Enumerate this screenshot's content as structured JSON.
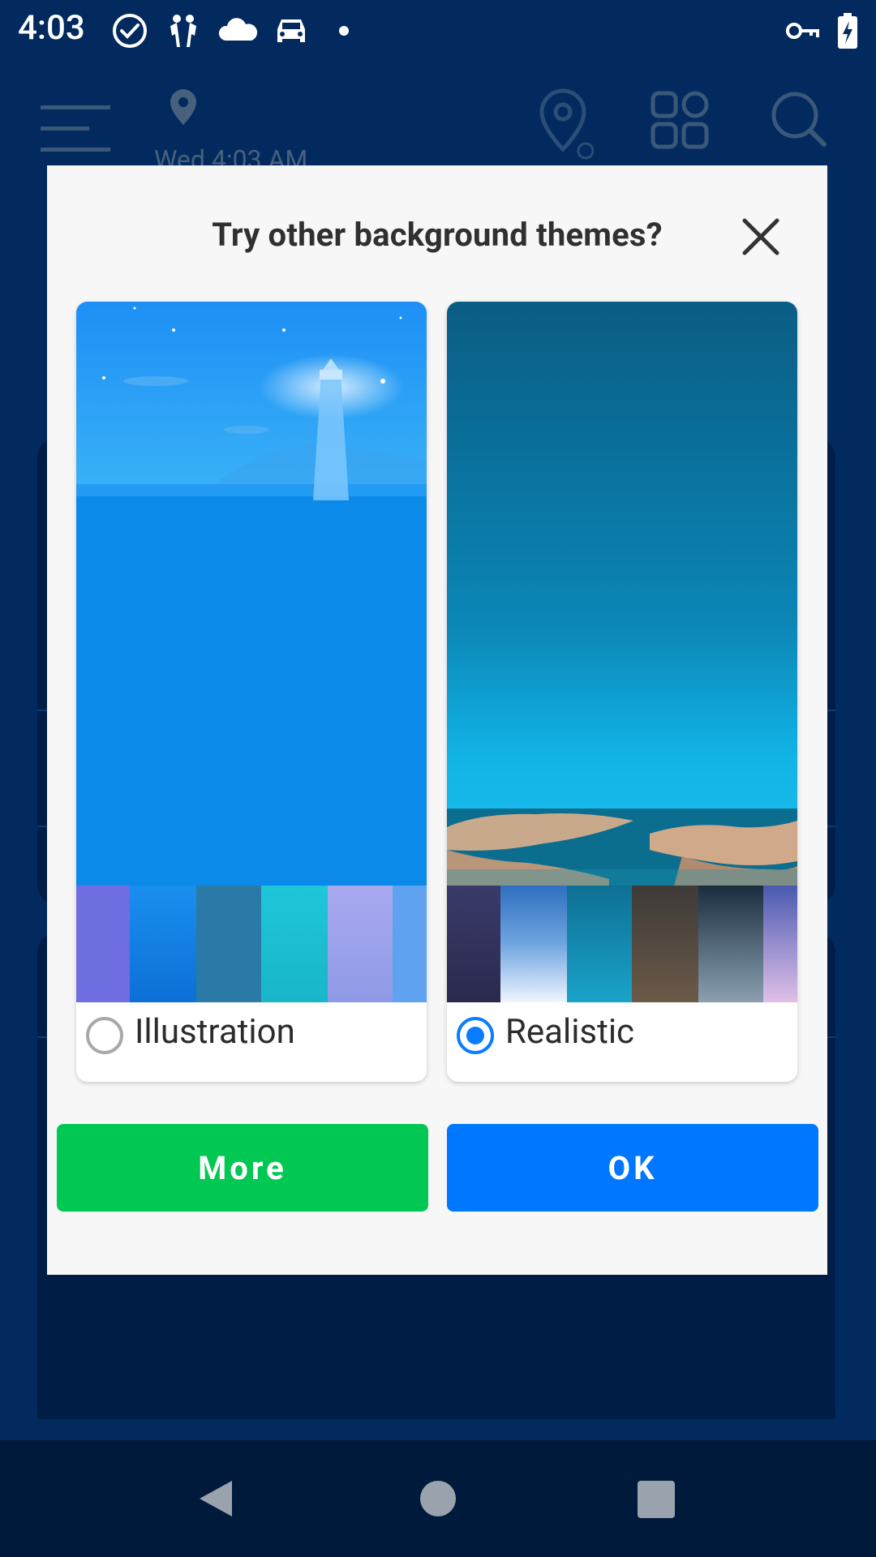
{
  "status_bar": {
    "time": "4:03"
  },
  "app_header": {
    "date_text": "Wed 4:03 AM"
  },
  "dialog": {
    "title": "Try other background themes?",
    "options": [
      {
        "label": "Illustration",
        "selected": false
      },
      {
        "label": "Realistic",
        "selected": true
      }
    ],
    "more_label": "More",
    "ok_label": "OK"
  },
  "colors": {
    "more_button": "#00c853",
    "ok_button": "#0077ff",
    "radio_selected": "#0a7cff"
  }
}
